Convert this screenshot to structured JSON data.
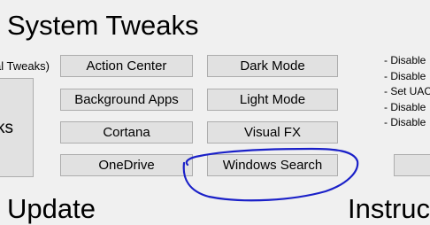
{
  "title": "System Tweaks",
  "group_label": "al Tweaks)",
  "big_button_label": "ks",
  "buttons": {
    "action_center": "Action Center",
    "background_apps": "Background Apps",
    "cortana": "Cortana",
    "onedrive": "OneDrive",
    "dark_mode": "Dark Mode",
    "light_mode": "Light Mode",
    "visual_fx": "Visual FX",
    "windows_search": "Windows Search"
  },
  "descriptions": [
    "- Disable",
    "- Disable",
    "- Set UAC",
    "- Disable",
    "- Disable"
  ],
  "sections": {
    "update": "Update",
    "instructions": "Instruc"
  },
  "colors": {
    "background": "#f0f0f0",
    "button": "#e1e1e1",
    "button_border": "#adadad",
    "annotation_ink": "#1a20c8"
  }
}
